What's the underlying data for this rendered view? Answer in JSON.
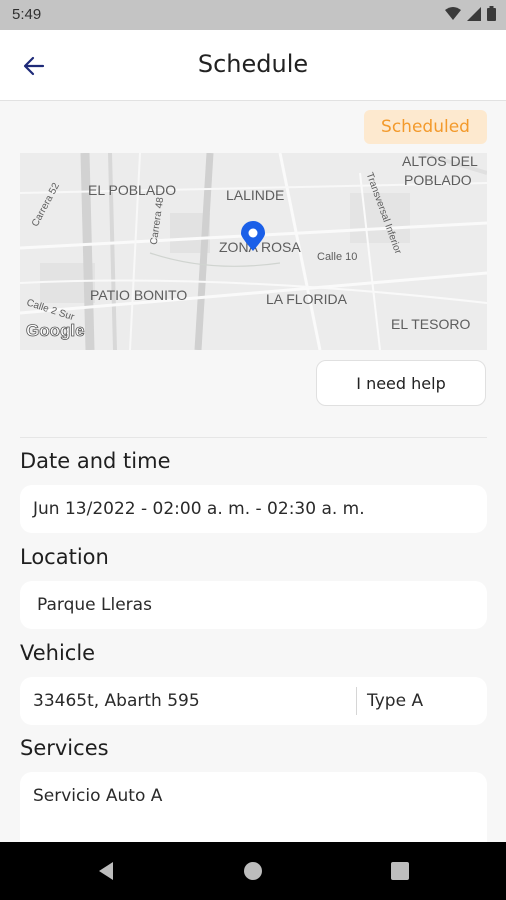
{
  "status_bar": {
    "time": "5:49",
    "icons": [
      "wifi-icon",
      "cell-signal-icon",
      "battery-icon"
    ]
  },
  "app_bar": {
    "title": "Schedule",
    "back_icon": "arrow-left-icon"
  },
  "status_badge": {
    "label": "Scheduled",
    "bg": "#fde9cf",
    "color": "#f39a2c"
  },
  "map": {
    "labels": [
      "EL POBLADO",
      "LALINDE",
      "ALTOS DEL",
      "POBLADO",
      "ZONA ROSA",
      "Calle 10",
      "PATIO BONITO",
      "LA FLORIDA",
      "EL TESORO",
      "Carrera 52",
      "Carrera 48",
      "Transversal Inferior",
      "Calle 2 Sur"
    ],
    "logo": "Google",
    "pin_color": "#1a5fe8"
  },
  "help_button": {
    "label": "I need help"
  },
  "date_time": {
    "label": "Date and time",
    "value": "Jun 13/2022 - 02:00 a. m. - 02:30 a. m."
  },
  "location": {
    "label": "Location",
    "value": "Parque Lleras"
  },
  "vehicle": {
    "label": "Vehicle",
    "value": "33465t, Abarth 595",
    "type": "Type A"
  },
  "services": {
    "label": "Services",
    "value": "Servicio Auto A"
  },
  "nav": {
    "icons": [
      "back-triangle-icon",
      "home-circle-icon",
      "recents-square-icon"
    ]
  }
}
